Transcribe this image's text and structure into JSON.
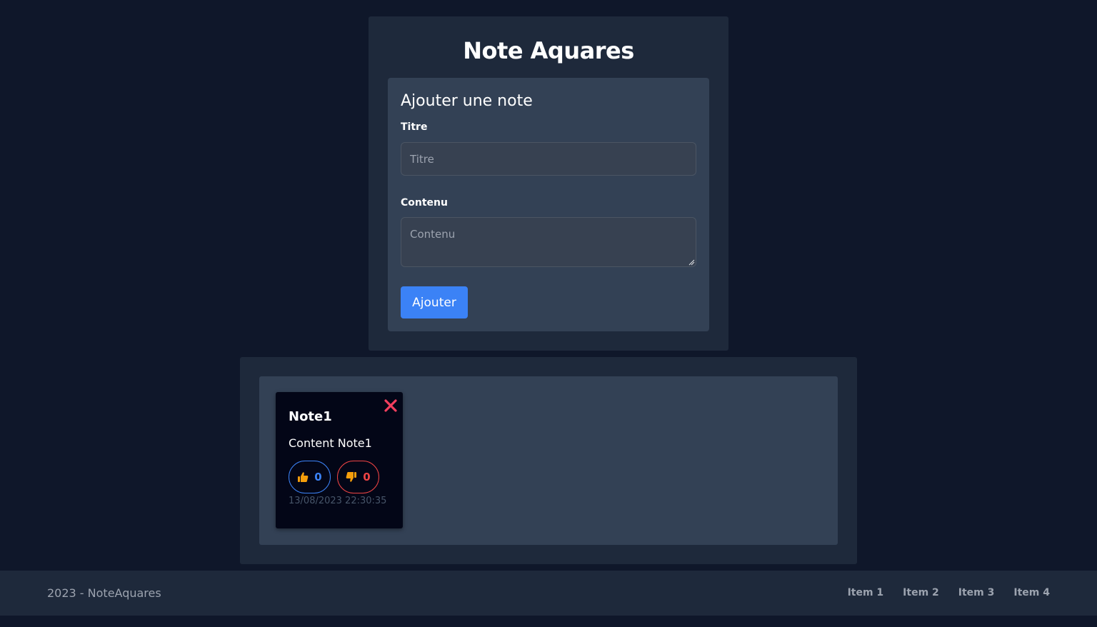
{
  "app": {
    "title": "Note Aquares"
  },
  "form": {
    "heading": "Ajouter une note",
    "title_label": "Titre",
    "title_placeholder": "Titre",
    "title_value": "",
    "content_label": "Contenu",
    "content_placeholder": "Contenu",
    "content_value": "",
    "submit_label": "Ajouter"
  },
  "notes": [
    {
      "title": "Note1",
      "content": "Content Note1",
      "likes": "0",
      "dislikes": "0",
      "date": "13/08/2023 22:30:35"
    }
  ],
  "footer": {
    "copyright": "2023 - NoteAquares",
    "links": [
      "Item 1",
      "Item 2",
      "Item 3",
      "Item 4"
    ]
  },
  "icons": {
    "delete": "close-icon",
    "like": "thumbs-up-icon",
    "dislike": "thumbs-down-icon"
  },
  "colors": {
    "page_bg": "#0f172a",
    "panel_bg": "#1e293b",
    "card_bg": "#334155",
    "note_bg": "#030617",
    "primary": "#3b82f6",
    "danger": "#ef4444",
    "icon_yellow": "#f59e0b"
  }
}
